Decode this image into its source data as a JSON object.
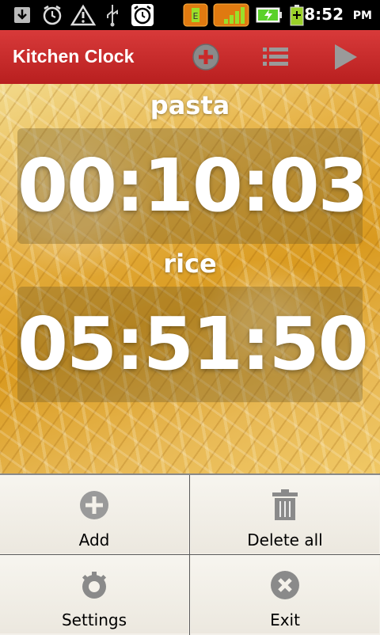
{
  "status_bar": {
    "time": "8:52",
    "ampm": "PM",
    "icons": [
      "download-icon",
      "alarm-icon",
      "warning-icon",
      "usb-icon",
      "alarm-clock-icon",
      "battery-app-icon",
      "signal-app-icon",
      "battery-charging-icon",
      "battery-icon"
    ]
  },
  "action_bar": {
    "title": "Kitchen Clock",
    "buttons": [
      "add-icon",
      "list-icon",
      "play-icon"
    ],
    "color": "#c92a2a"
  },
  "timers": [
    {
      "label": "pasta",
      "value": "00:10:03"
    },
    {
      "label": "rice",
      "value": "05:51:50"
    }
  ],
  "menu": {
    "items": [
      {
        "label": "Add",
        "icon": "add-icon"
      },
      {
        "label": "Delete all",
        "icon": "trash-icon"
      },
      {
        "label": "Settings",
        "icon": "settings-icon"
      },
      {
        "label": "Exit",
        "icon": "close-icon"
      }
    ]
  }
}
